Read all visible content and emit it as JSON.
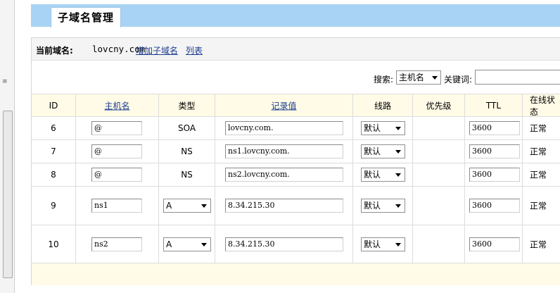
{
  "header": {
    "tab_title": "子域名管理"
  },
  "info": {
    "current_domain_label": "当前域名:",
    "current_domain_value": "lovcny.com",
    "add_subdomain_link": "增加子域名",
    "list_link": "列表"
  },
  "search": {
    "search_label": "搜索:",
    "field_selected": "主机名",
    "keyword_label": "关键词:",
    "keyword_value": ""
  },
  "table": {
    "headers": {
      "id": "ID",
      "host": "主机名",
      "type": "类型",
      "value": "记录值",
      "line": "线路",
      "priority": "优先级",
      "ttl": "TTL",
      "status": "在线状态"
    },
    "rows": [
      {
        "id": "6",
        "host": "@",
        "type": "SOA",
        "type_editable": false,
        "value": "lovcny.com.",
        "line": "默认",
        "priority": "",
        "ttl": "3600",
        "status": "正常"
      },
      {
        "id": "7",
        "host": "@",
        "type": "NS",
        "type_editable": false,
        "value": "ns1.lovcny.com.",
        "line": "默认",
        "priority": "",
        "ttl": "3600",
        "status": "正常"
      },
      {
        "id": "8",
        "host": "@",
        "type": "NS",
        "type_editable": false,
        "value": "ns2.lovcny.com.",
        "line": "默认",
        "priority": "",
        "ttl": "3600",
        "status": "正常"
      },
      {
        "id": "9",
        "host": "ns1",
        "type": "A",
        "type_editable": true,
        "value": "8.34.215.30",
        "line": "默认",
        "priority": "",
        "ttl": "3600",
        "status": "正常"
      },
      {
        "id": "10",
        "host": "ns2",
        "type": "A",
        "type_editable": true,
        "value": "8.34.215.30",
        "line": "默认",
        "priority": "",
        "ttl": "3600",
        "status": "正常"
      }
    ]
  },
  "colors": {
    "header_band": "#a9d3f4",
    "link": "#1c3d8f",
    "table_header_bg": "#fffbe7",
    "info_bar_bg": "#f4f4f4"
  }
}
